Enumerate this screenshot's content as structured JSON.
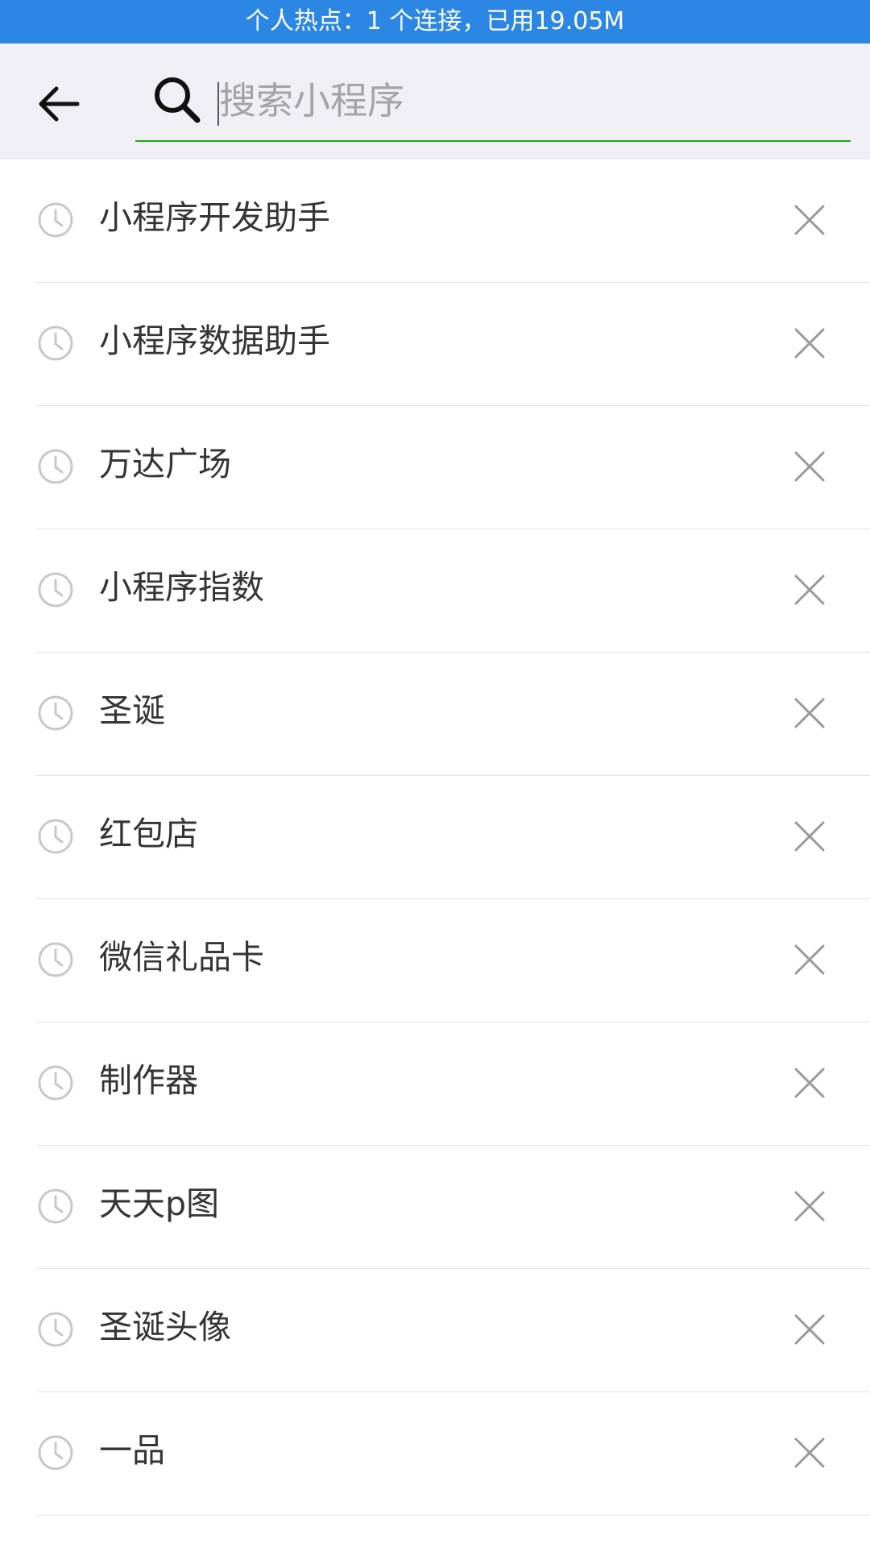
{
  "status_bar": {
    "text": "个人热点：1 个连接，已用19.05M"
  },
  "search": {
    "placeholder": "搜索小程序",
    "value": ""
  },
  "icons": {
    "back": "arrow-left-icon",
    "search": "search-icon",
    "history": "clock-icon",
    "delete": "close-icon"
  },
  "colors": {
    "status_bar": "#2b87e3",
    "accent_underline": "#1aad19",
    "header_bg": "#efeff4"
  },
  "history": {
    "items": [
      {
        "label": "小程序开发助手"
      },
      {
        "label": "小程序数据助手"
      },
      {
        "label": "万达广场"
      },
      {
        "label": "小程序指数"
      },
      {
        "label": "圣诞"
      },
      {
        "label": "红包店"
      },
      {
        "label": "微信礼品卡"
      },
      {
        "label": "制作器"
      },
      {
        "label": "天天p图"
      },
      {
        "label": "圣诞头像"
      },
      {
        "label": "一品"
      }
    ]
  }
}
